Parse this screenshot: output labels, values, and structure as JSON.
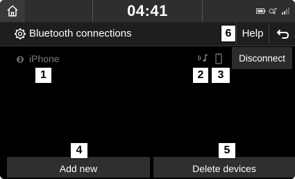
{
  "status_bar": {
    "time": "04:41",
    "home_icon": "home-icon",
    "status_icons": [
      "battery-icon",
      "bluetooth-audio-icon",
      "signal-icon"
    ]
  },
  "title_bar": {
    "title": "Bluetooth connections",
    "settings_icon": "gear-icon",
    "help_label": "Help",
    "back_icon": "back-arrow-icon"
  },
  "device": {
    "name": "iPhone",
    "icon": "bluetooth-icon",
    "audio_icon": "bluetooth-audio-icon",
    "phone_icon": "phone-icon",
    "disconnect_label": "Disconnect"
  },
  "bottom": {
    "add_new_label": "Add new",
    "delete_devices_label": "Delete devices"
  },
  "callouts": [
    "1",
    "2",
    "3",
    "4",
    "5",
    "6"
  ]
}
